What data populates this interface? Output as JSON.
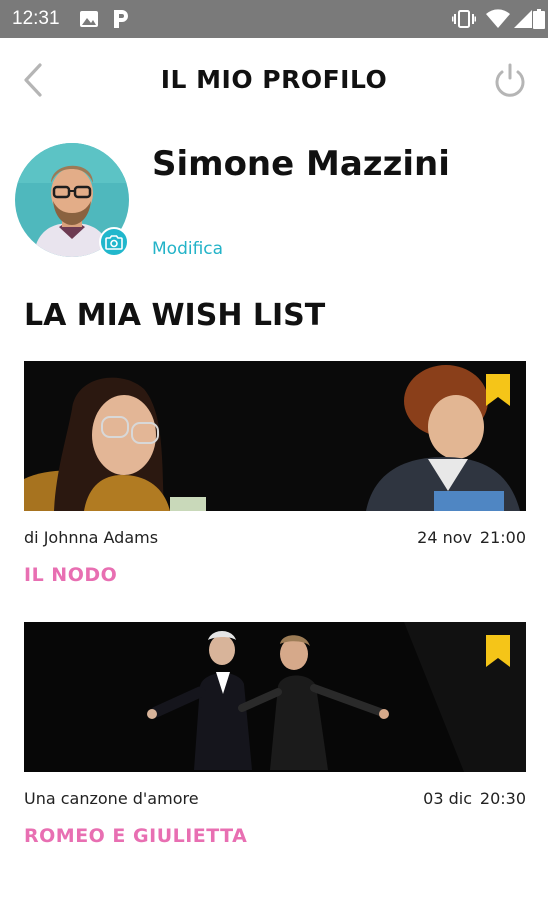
{
  "status_bar": {
    "time": "12:31",
    "left_icons": [
      "image-icon",
      "parking-icon"
    ],
    "right_icons": [
      "vibrate-icon",
      "wifi-icon",
      "signal-icon",
      "battery-icon"
    ]
  },
  "header": {
    "title": "IL MIO PROFILO",
    "back_icon": "chevron-left-icon",
    "power_icon": "power-icon"
  },
  "profile": {
    "name": "Simone Mazzini",
    "edit_label": "Modifica",
    "camera_icon": "camera-icon"
  },
  "wishlist": {
    "title": "LA MIA WISH LIST",
    "items": [
      {
        "subtitle": "di Johnna Adams",
        "date": "24 nov",
        "time": "21:00",
        "title": "IL NODO"
      },
      {
        "subtitle": "Una canzone d'amore",
        "date": "03 dic",
        "time": "20:30",
        "title": "ROMEO E GIULIETTA"
      }
    ]
  },
  "colors": {
    "accent_teal": "#23b3c8",
    "title_pink": "#e86fb2",
    "bookmark_yellow": "#f5c518",
    "status_bar": "#7a7a7a"
  }
}
